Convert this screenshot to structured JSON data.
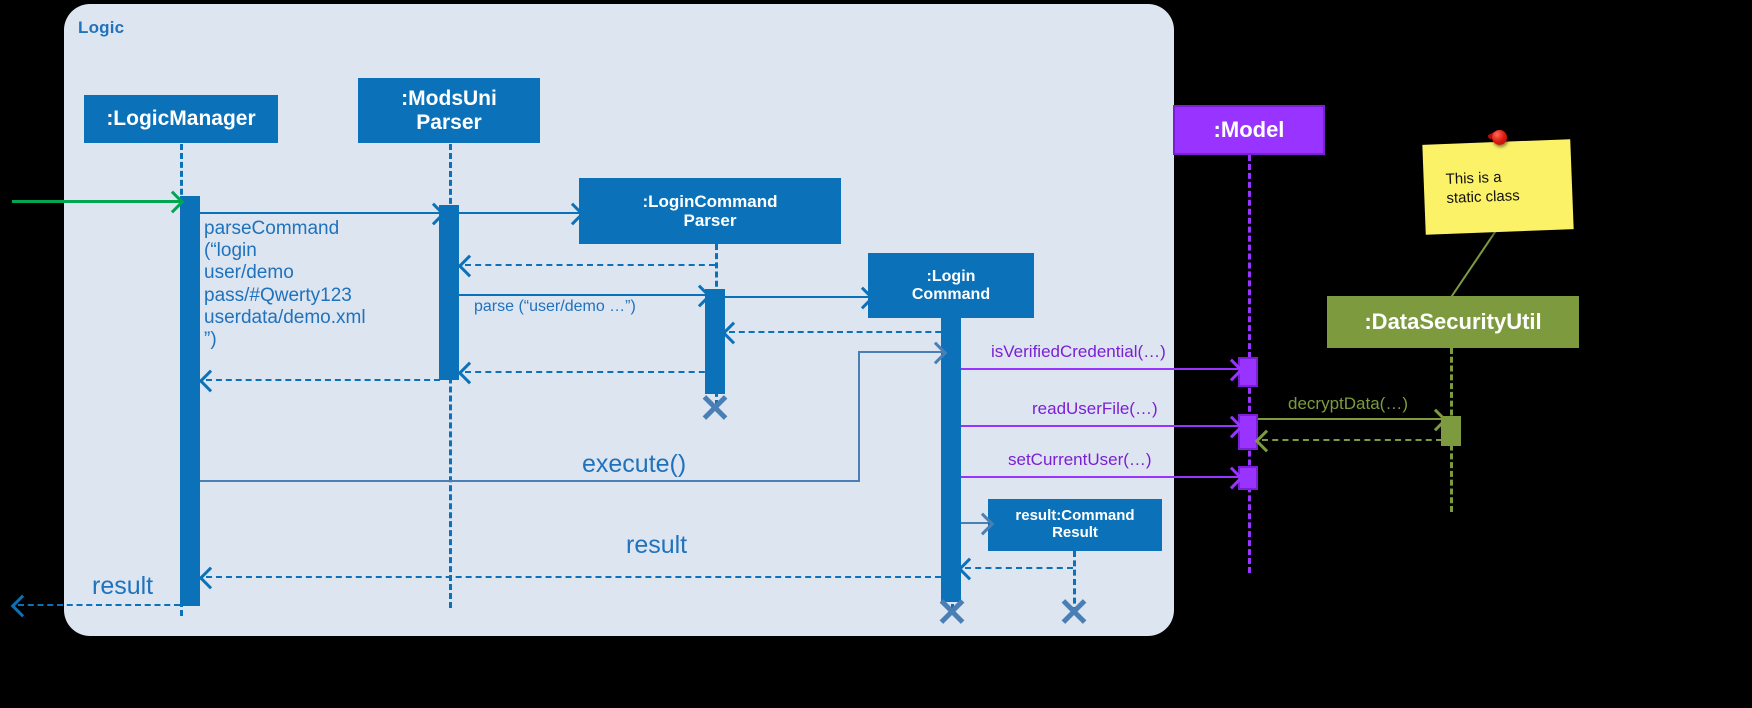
{
  "diagram": {
    "kind": "uml-sequence-diagram",
    "frame_label": "Logic",
    "background_color": "#000000",
    "frame_color": "#dde5f0"
  },
  "participants": [
    {
      "id": "logicmanager",
      "label": ":LogicManager",
      "color": "#0b72ba",
      "text_color": "#ffffff"
    },
    {
      "id": "modsuniparser",
      "label": ":ModsUni\nParser",
      "color": "#0b72ba",
      "text_color": "#ffffff"
    },
    {
      "id": "logincmdparser",
      "label": ":LoginCommand\nParser",
      "color": "#0b72ba",
      "text_color": "#ffffff"
    },
    {
      "id": "logincommand",
      "label": ":Login\nCommand",
      "color": "#0b72ba",
      "text_color": "#ffffff"
    },
    {
      "id": "commandresult",
      "label": "result:Command\nResult",
      "color": "#0b72ba",
      "text_color": "#ffffff"
    },
    {
      "id": "model",
      "label": ":Model",
      "color": "#9933ff",
      "text_color": "#ffffff"
    },
    {
      "id": "datasecurityutil",
      "label": ":DataSecurityUtil",
      "color": "#7d9b3e",
      "text_color": "#ffffff"
    }
  ],
  "messages": [
    {
      "id": "m0",
      "label": "",
      "from": "external",
      "to": "logicmanager",
      "color": "#00a650",
      "style": "solid"
    },
    {
      "id": "m1",
      "label": "parseCommand\n(“login\nuser/demo\npass/#Qwerty123\nuserdata/demo.xml\n”)",
      "from": "logicmanager",
      "to": "modsuniparser",
      "color": "#1f72bd",
      "style": "solid"
    },
    {
      "id": "m2",
      "label": "",
      "from": "modsuniparser",
      "to": "logincmdparser",
      "color": "#1f72bd",
      "style": "solid"
    },
    {
      "id": "m3",
      "label": "",
      "from": "logincmdparser",
      "to": "modsuniparser",
      "color": "#1f72bd",
      "style": "dashed"
    },
    {
      "id": "m4",
      "label": "parse (“user/demo …”)",
      "from": "modsuniparser",
      "to": "logincmdparser",
      "color": "#1f72bd",
      "style": "solid"
    },
    {
      "id": "m5",
      "label": "",
      "from": "logincmdparser",
      "to": "logincommand",
      "color": "#1f72bd",
      "style": "solid"
    },
    {
      "id": "m6",
      "label": "",
      "from": "logincommand",
      "to": "logincmdparser",
      "color": "#1f72bd",
      "style": "dashed"
    },
    {
      "id": "m7",
      "label": "",
      "from": "logincmdparser",
      "to": "modsuniparser",
      "color": "#1f72bd",
      "style": "dashed"
    },
    {
      "id": "m8",
      "label": "",
      "from": "modsuniparser",
      "to": "logicmanager",
      "color": "#1f72bd",
      "style": "dashed"
    },
    {
      "id": "m9",
      "label": "execute()",
      "from": "logicmanager",
      "to": "logincommand",
      "color": "#1f72bd",
      "style": "solid"
    },
    {
      "id": "m10",
      "label": "isVerifiedCredential(…)",
      "from": "logincommand",
      "to": "model",
      "color": "#7b1fd4",
      "style": "solid"
    },
    {
      "id": "m11",
      "label": "readUserFile(…)",
      "from": "logincommand",
      "to": "model",
      "color": "#7b1fd4",
      "style": "solid"
    },
    {
      "id": "m12",
      "label": "decryptData(…)",
      "from": "model",
      "to": "datasecurityutil",
      "color": "#7d9b3e",
      "style": "solid"
    },
    {
      "id": "m13",
      "label": "",
      "from": "datasecurityutil",
      "to": "model",
      "color": "#7d9b3e",
      "style": "dashed"
    },
    {
      "id": "m14",
      "label": "setCurrentUser(…)",
      "from": "logincommand",
      "to": "model",
      "color": "#7b1fd4",
      "style": "solid"
    },
    {
      "id": "m15",
      "label": "",
      "from": "logincommand",
      "to": "commandresult",
      "color": "#4a7fb5",
      "style": "solid"
    },
    {
      "id": "m16",
      "label": "",
      "from": "commandresult",
      "to": "logincommand",
      "color": "#1f72bd",
      "style": "dashed"
    },
    {
      "id": "m17",
      "label": "result",
      "from": "logincommand",
      "to": "logicmanager",
      "color": "#1f72bd",
      "style": "dashed"
    },
    {
      "id": "m18",
      "label": "result",
      "from": "logicmanager",
      "to": "external",
      "color": "#1f72bd",
      "style": "dashed"
    }
  ],
  "labels": {
    "parse_command": "parseCommand\n(“login\nuser/demo\npass/#Qwerty123\nuserdata/demo.xml\n”)",
    "parse_user_demo": "parse (“user/demo …”)",
    "execute": "execute()",
    "is_verified_credential": "isVerifiedCredential(…)",
    "read_user_file": "readUserFile(…)",
    "decrypt_data": "decryptData(…)",
    "set_current_user": "setCurrentUser(…)",
    "result_mid": "result",
    "result_left": "result"
  },
  "note": {
    "text": "This is a\nstatic class",
    "background": "#fbf267",
    "pin_color": "#e01b10",
    "attached_to": "datasecurityutil"
  },
  "destructions": [
    {
      "for": "logincmdparser"
    },
    {
      "for": "logincommand"
    },
    {
      "for": "commandresult"
    }
  ]
}
